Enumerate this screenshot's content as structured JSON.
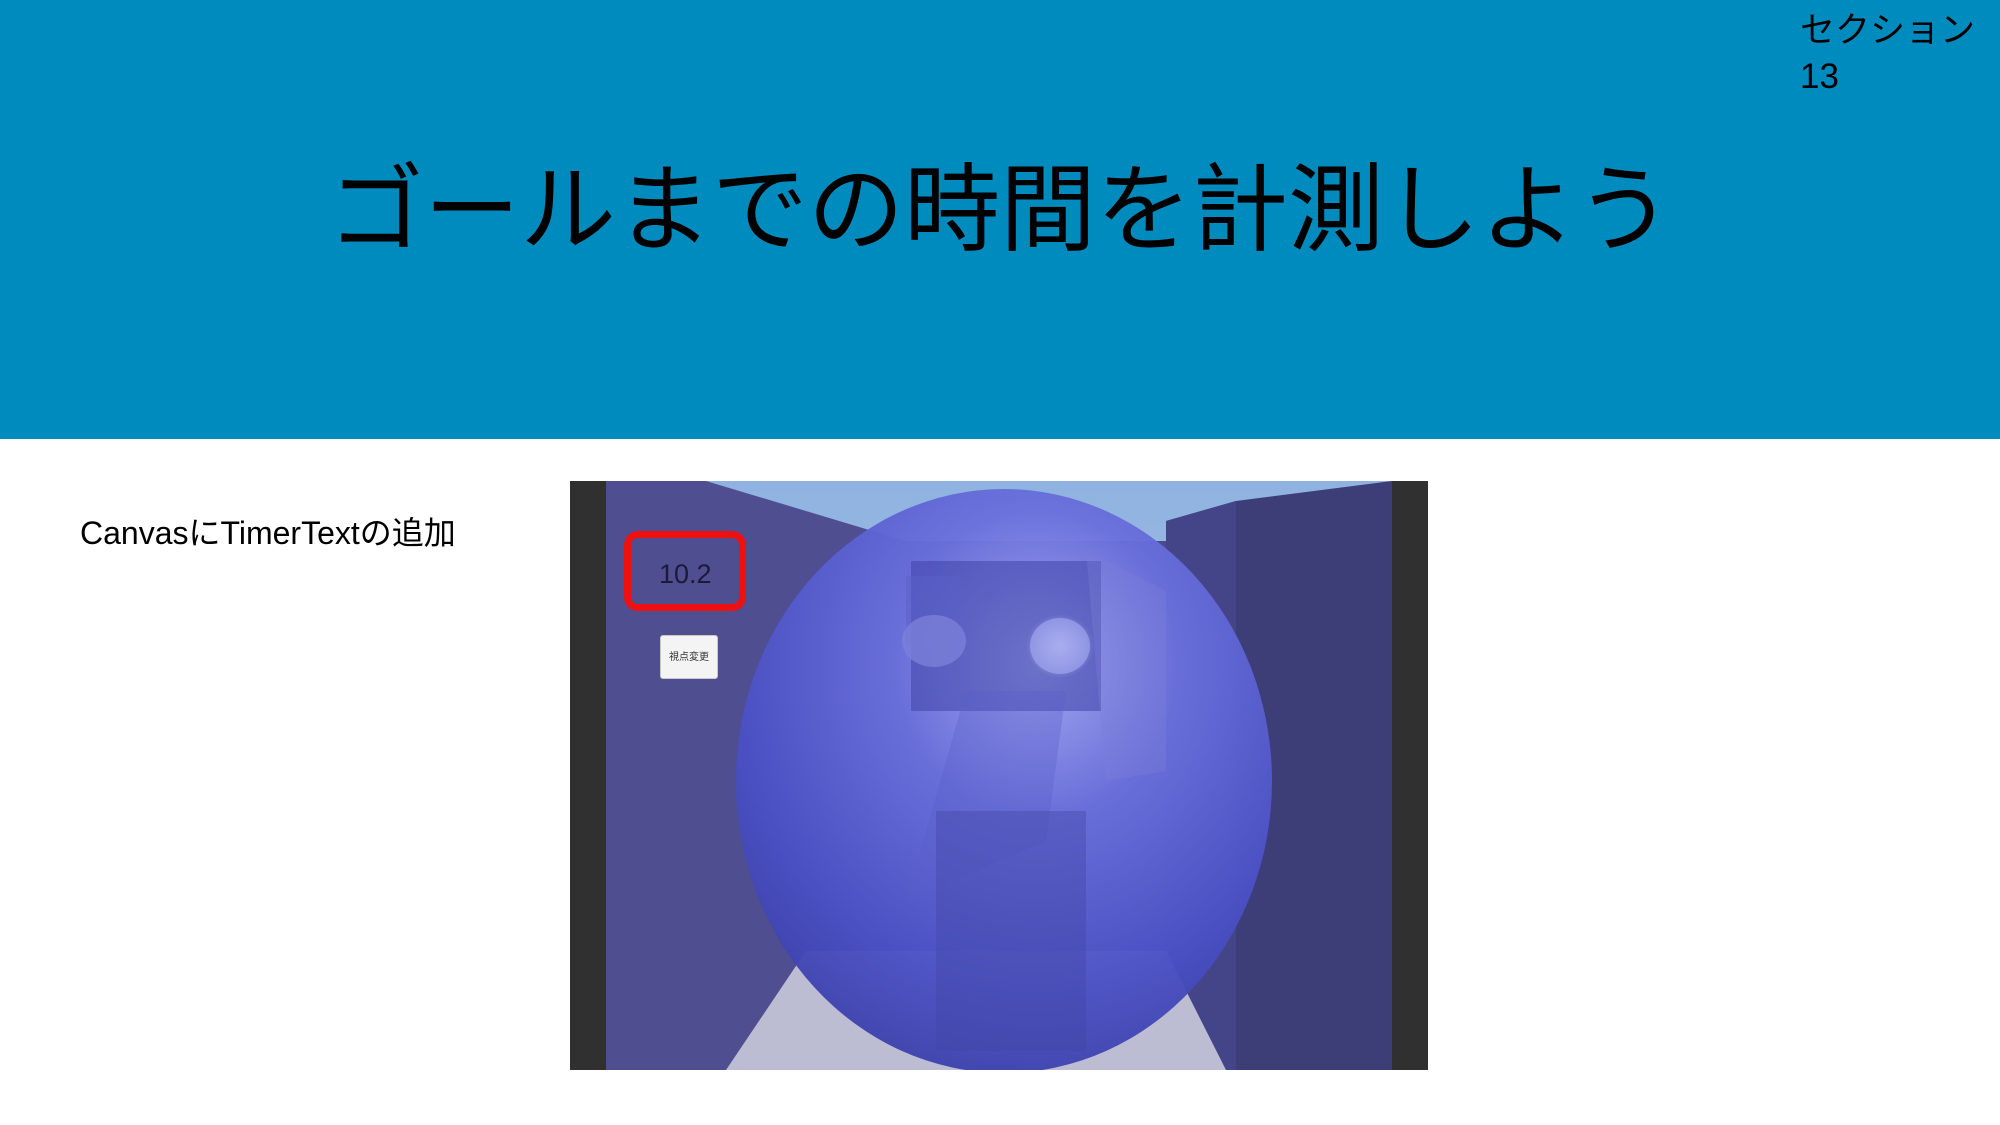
{
  "slide": {
    "section_label": "セクション",
    "section_number": "13",
    "title": "ゴールまでの時間を計測しよう",
    "caption": "CanvasにTimerTextの追加"
  },
  "game_view": {
    "timer_text": "10.2",
    "view_button_label": "視点変更"
  },
  "colors": {
    "header": "#008bbf",
    "highlight": "#ee1111",
    "wall": "#4a4a8c",
    "ball": "#4a50c8"
  }
}
